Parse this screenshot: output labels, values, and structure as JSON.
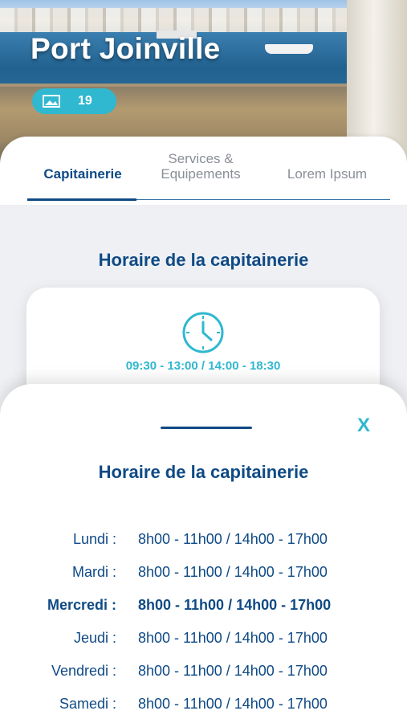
{
  "hero": {
    "title": "Port Joinville",
    "photo_count": "19"
  },
  "tabs": [
    {
      "label": "Capitainerie",
      "active": true
    },
    {
      "label": "Services &\nEquipements",
      "active": false
    },
    {
      "label": "Lorem Ipsum",
      "active": false
    }
  ],
  "section": {
    "title": "Horaire de la capitainerie"
  },
  "hours_card": {
    "summary": "09:30 - 13:00 / 14:00 - 18:30"
  },
  "sheet": {
    "title": "Horaire de la capitainerie",
    "close_label": "X",
    "schedule": [
      {
        "day": "Lundi :",
        "hours": "8h00 - 11h00 / 14h00 - 17h00"
      },
      {
        "day": "Mardi :",
        "hours": "8h00 - 11h00 / 14h00 - 17h00"
      },
      {
        "day": "Mercredi :",
        "hours": "8h00 - 11h00 / 14h00 - 17h00",
        "today": true
      },
      {
        "day": "Jeudi :",
        "hours": "8h00 - 11h00 / 14h00 - 17h00"
      },
      {
        "day": "Vendredi :",
        "hours": "8h00 - 11h00 / 14h00 - 17h00"
      },
      {
        "day": "Samedi :",
        "hours": "8h00 - 11h00 / 14h00 - 17h00"
      }
    ]
  },
  "colors": {
    "primary": "#0f4a85",
    "accent": "#2fb8cf"
  },
  "icons": {
    "photo": "image-icon",
    "clock": "clock-icon"
  }
}
